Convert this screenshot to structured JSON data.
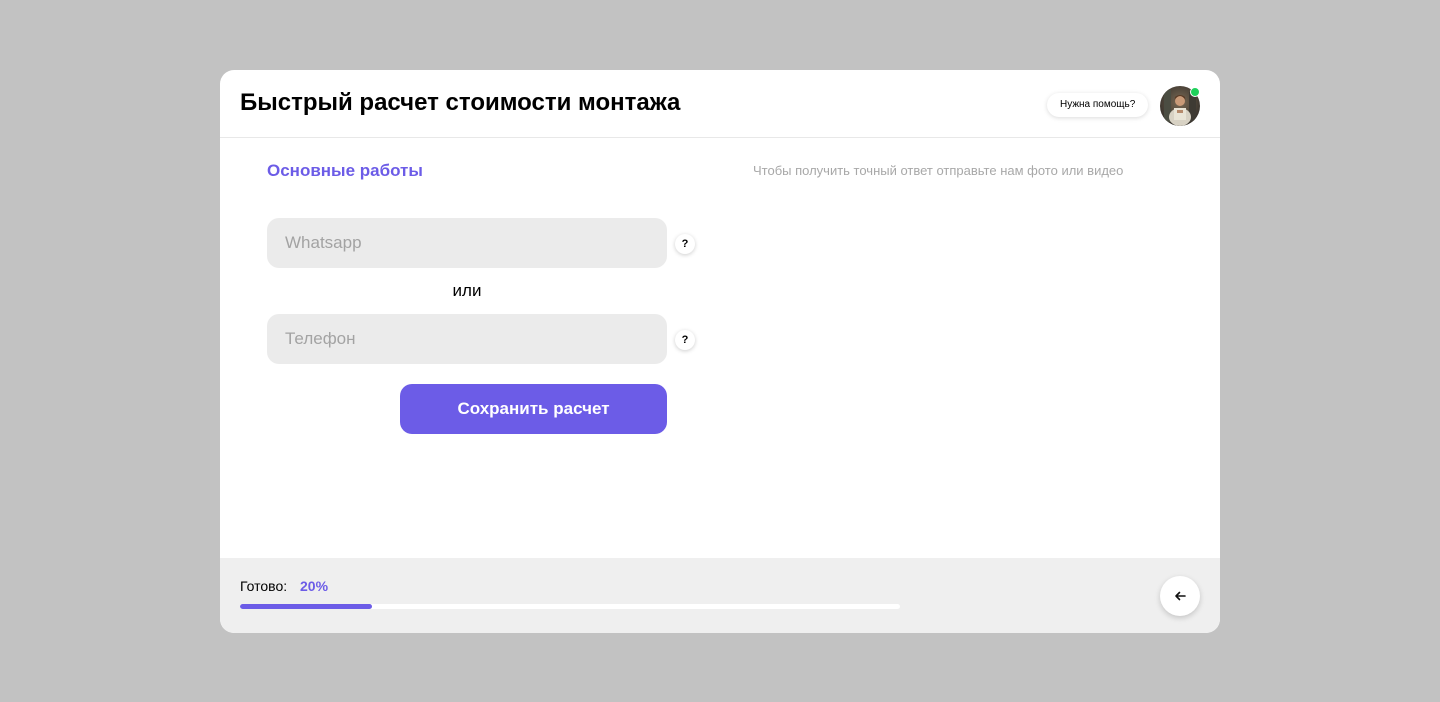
{
  "header": {
    "title": "Быстрый расчет стоимости монтажа",
    "help_text": "Нужна помощь?",
    "avatar_icon": "user-avatar-photo",
    "online_color": "#1fd15b"
  },
  "form": {
    "section_title": "Основные работы",
    "hint": "Чтобы получить точный ответ отправьте нам фото или видео",
    "whatsapp_placeholder": "Whatsapp",
    "whatsapp_value": "",
    "or_label": "или",
    "phone_placeholder": "Телефон",
    "phone_value": "",
    "help_badge": "?",
    "save_label": "Сохранить расчет"
  },
  "footer": {
    "progress_label": "Готово:",
    "progress_text": "20%",
    "progress_fraction": 0.2,
    "back_icon": "arrow-left-icon"
  },
  "colors": {
    "accent": "#6c5ce7",
    "backdrop": "#c2c2c2",
    "field_bg": "#ebebeb"
  }
}
